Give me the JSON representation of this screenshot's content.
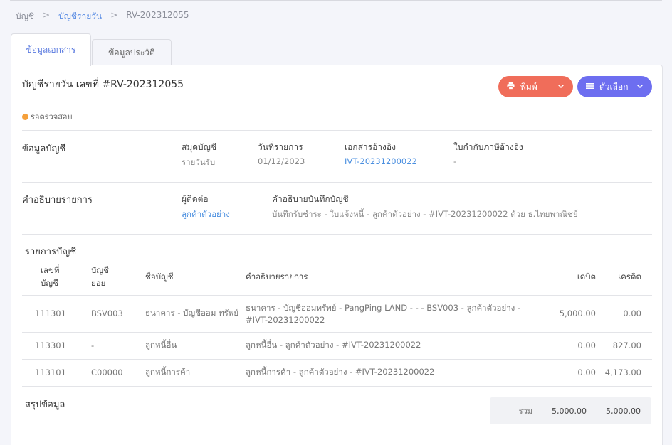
{
  "breadcrumb": {
    "root": "บัญชี",
    "section": "บัญชีรายวัน",
    "current": "RV-202312055",
    "separator": ">"
  },
  "tabs": [
    {
      "label": "ข้อมูลเอกสาร",
      "active": true
    },
    {
      "label": "ข้อมูลประวัติ",
      "active": false
    }
  ],
  "header": {
    "title": "บัญชีรายวัน เลขที่ #RV-202312055",
    "print_label": "พิมพ์",
    "options_label": "ตัวเลือก"
  },
  "status": {
    "label": "รอตรวจสอบ",
    "color": "#f5a03b"
  },
  "account_info": {
    "section_title": "ข้อมูลบัญชี",
    "book_label": "สมุดบัญชี",
    "book_value": "รายวันรับ",
    "date_label": "วันที่รายการ",
    "date_value": "01/12/2023",
    "ref_doc_label": "เอกสารอ้างอิง",
    "ref_doc_value": "IVT-20231200022",
    "tax_ref_label": "ใบกำกับภาษีอ้างอิง",
    "tax_ref_value": "-"
  },
  "description": {
    "section_title": "คำอธิบายรายการ",
    "contact_label": "ผู้ติดต่อ",
    "contact_value": "ลูกค้าตัวอย่าง",
    "note_label": "คำอธิบายบันทึกบัญชี",
    "note_value": "บันทึกรับชำระ - ใบแจ้งหนี้ - ลูกค้าตัวอย่าง - #IVT-20231200022 ด้วย ธ.ไทยพาณิชย์"
  },
  "entries": {
    "section_title": "รายการบัญชี",
    "columns": {
      "account_no_1": "เลขที่",
      "account_no_2": "บัญชี",
      "sub_1": "บัญชี",
      "sub_2": "ย่อย",
      "name": "ชื่อบัญชี",
      "desc": "คำอธิบายรายการ",
      "debit": "เดบิต",
      "credit": "เครดิต"
    },
    "rows": [
      {
        "no": "111301",
        "sub": "BSV003",
        "name": "ธนาคาร - บัญชีออม ทรัพย์",
        "desc": "ธนาคาร - บัญชีออมทรัพย์ - PangPing LAND - - - BSV003 - ลูกค้าตัวอย่าง - #IVT-20231200022",
        "debit": "5,000.00",
        "credit": "0.00"
      },
      {
        "no": "113301",
        "sub": "-",
        "name": "ลูกหนี้อื่น",
        "desc": "ลูกหนี้อื่น - ลูกค้าตัวอย่าง - #IVT-20231200022",
        "debit": "0.00",
        "credit": "827.00"
      },
      {
        "no": "113101",
        "sub": "C00000",
        "name": "ลูกหนี้การค้า",
        "desc": "ลูกหนี้การค้า - ลูกค้าตัวอย่าง - #IVT-20231200022",
        "debit": "0.00",
        "credit": "4,173.00"
      }
    ]
  },
  "summary": {
    "section_title": "สรุปข้อมูล",
    "total_label": "รวม",
    "total_debit": "5,000.00",
    "total_credit": "5,000.00"
  }
}
